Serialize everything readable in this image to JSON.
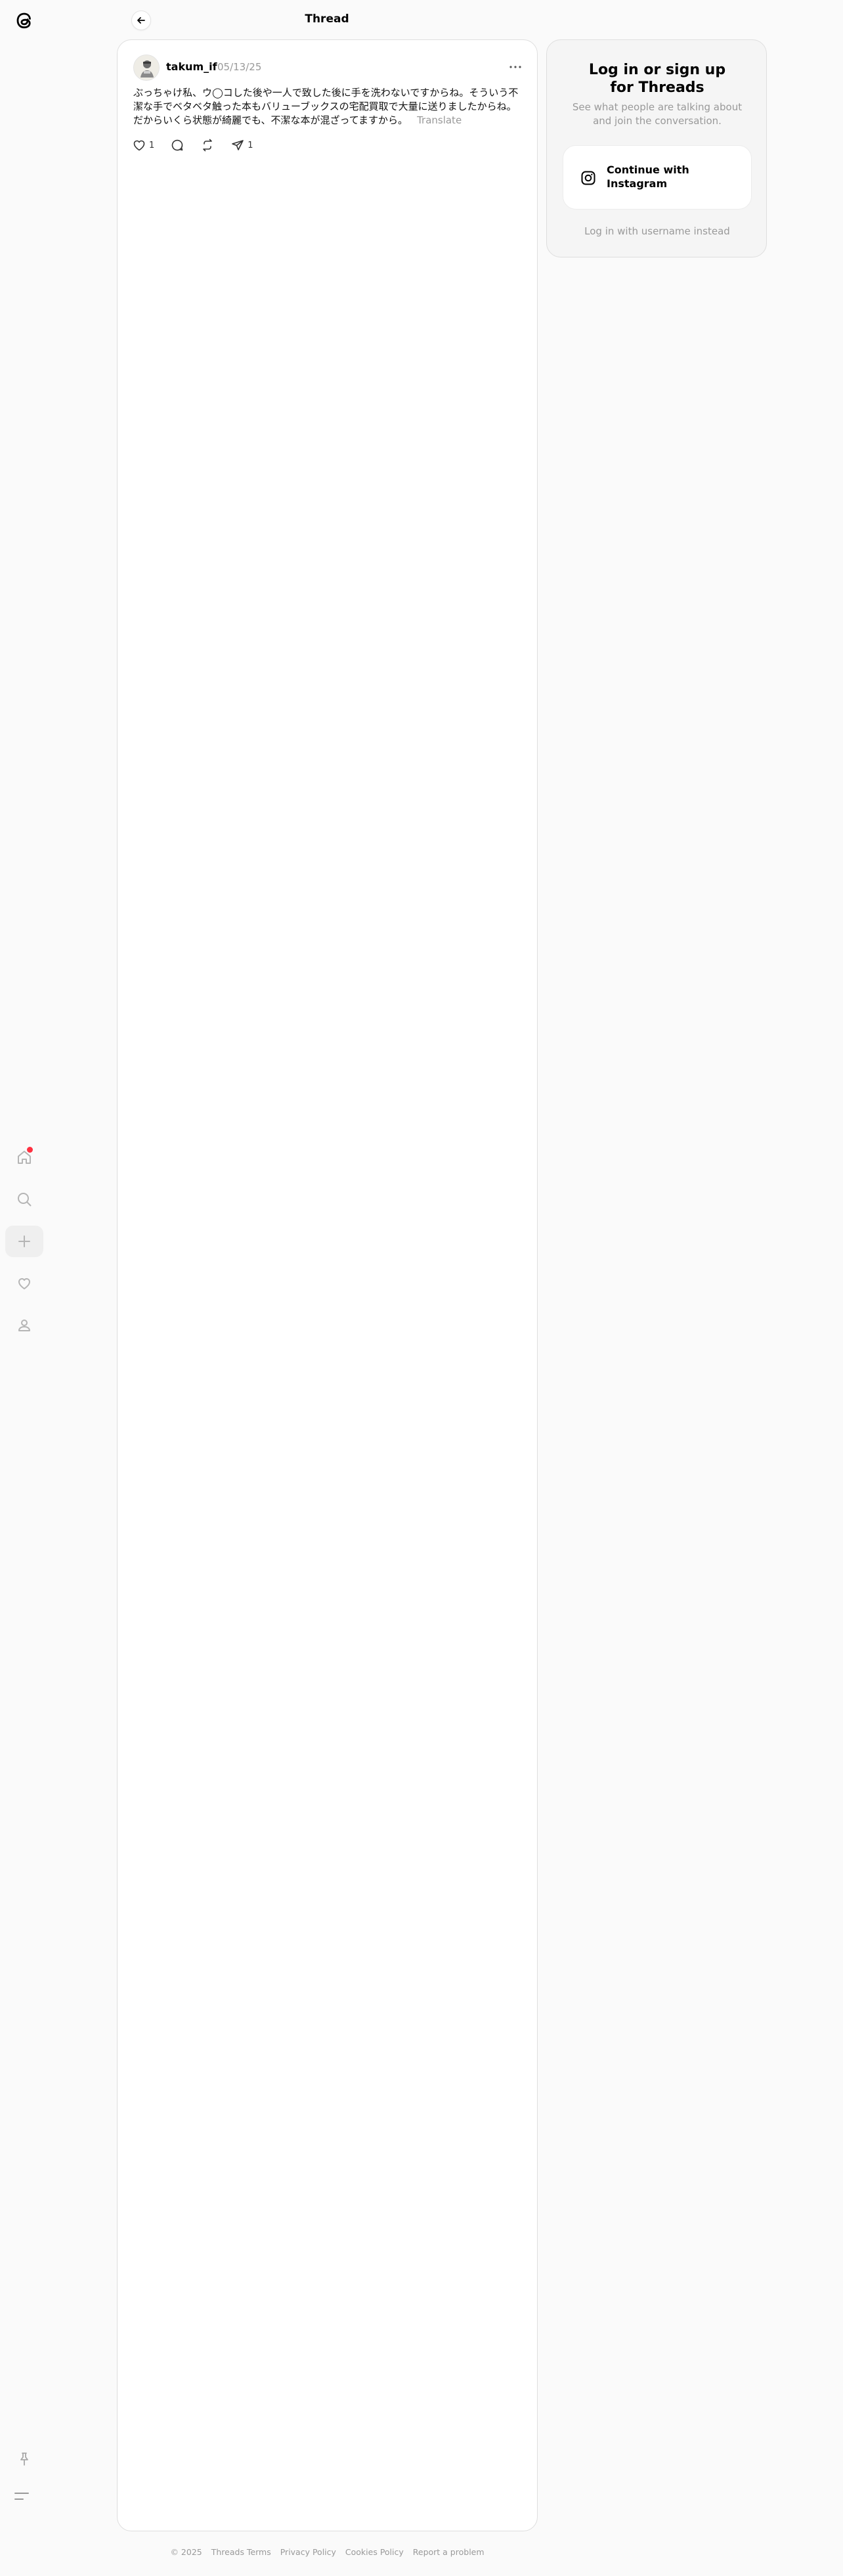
{
  "header": {
    "title": "Thread"
  },
  "nav": {
    "items": [
      {
        "name": "home",
        "icon": "home-icon",
        "notification": true
      },
      {
        "name": "search",
        "icon": "search-icon"
      },
      {
        "name": "create",
        "icon": "plus-icon",
        "active": true
      },
      {
        "name": "activity",
        "icon": "heart-icon"
      },
      {
        "name": "profile",
        "icon": "person-icon"
      }
    ],
    "bottom": [
      {
        "name": "pin",
        "icon": "pin-icon"
      },
      {
        "name": "menu",
        "icon": "menu-icon"
      }
    ]
  },
  "post": {
    "username": "takum_if",
    "timestamp": "05/13/25",
    "text": "ぶっちゃけ私、ウ◯コした後や一人で致した後に手を洗わないですからね。そういう不潔な手でベタベタ触った本もバリューブックスの宅配買取で大量に送りましたからね。だからいくら状態が綺麗でも、不潔な本が混ざってますから。",
    "translate_label": "Translate",
    "likes": "1",
    "shares": "1"
  },
  "login": {
    "title": "Log in or sign up for Threads",
    "subtitle": "See what people are talking about and join the conversation.",
    "instagram_button": "Continue with Instagram",
    "alt_login": "Log in with username instead"
  },
  "footer": {
    "copyright": "© 2025",
    "links": [
      "Threads Terms",
      "Privacy Policy",
      "Cookies Policy",
      "Report a problem"
    ]
  },
  "colors": {
    "notification": "#ff3040",
    "muted": "#999999",
    "background": "#fafafa"
  }
}
